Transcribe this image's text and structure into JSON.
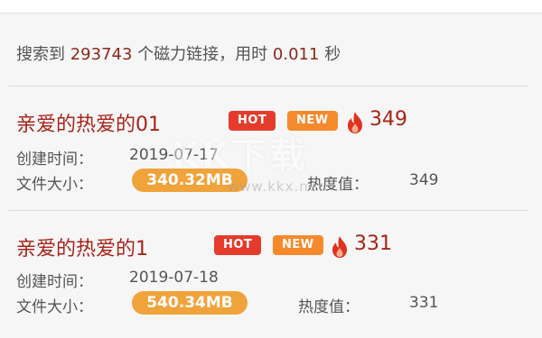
{
  "summary": {
    "prefix": "搜索到",
    "count": "293743",
    "middle": "个磁力链接，用时",
    "time": "0.011",
    "suffix": "秒"
  },
  "badges": {
    "hot": "HOT",
    "new": "NEW"
  },
  "labels": {
    "created": "创建时间：",
    "size": "文件大小：",
    "heat": "热度值："
  },
  "results": [
    {
      "title": "亲爱的热爱的01",
      "heat": "349",
      "created": "2019-07-17",
      "size": "340.32MB"
    },
    {
      "title": "亲爱的热爱的1",
      "heat": "331",
      "created": "2019-07-18",
      "size": "540.34MB"
    }
  ],
  "watermark": {
    "main": "KK下载",
    "sub": "www.kkx.net"
  },
  "colors": {
    "title": "#a8241a",
    "hot": "#e53b2c",
    "new": "#f58a2c",
    "size_pill": "#f0a33a",
    "flame": "#e0321f"
  },
  "icons": {
    "flame": "flame-icon"
  }
}
